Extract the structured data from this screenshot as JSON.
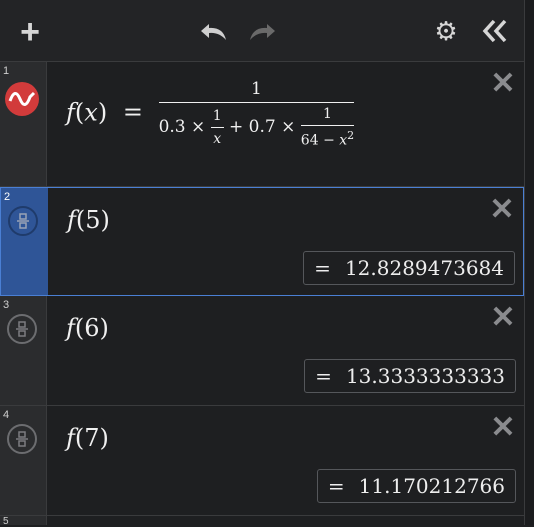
{
  "toolbar": {
    "add_icon": "plus-icon",
    "undo_icon": "undo-icon",
    "redo_icon": "redo-icon",
    "settings_icon": "gear-icon",
    "collapse_icon": "double-chevron-left-icon"
  },
  "expressions": [
    {
      "index": "1",
      "icon": "function-wave-icon",
      "fname": "f",
      "var": "x",
      "numerator": "1",
      "term1_coef": "0.3",
      "term1_num": "1",
      "term1_den": "x",
      "term2_coef": "0.7",
      "term2_num": "1",
      "term2_den_const": "64",
      "term2_den_var": "x",
      "term2_den_exp": "2"
    },
    {
      "index": "2",
      "icon": "fraction-toggle-icon",
      "fname": "f",
      "arg": "5",
      "result": "12.8289473684",
      "active": true
    },
    {
      "index": "3",
      "icon": "fraction-toggle-icon",
      "fname": "f",
      "arg": "6",
      "result": "13.3333333333"
    },
    {
      "index": "4",
      "icon": "fraction-toggle-icon",
      "fname": "f",
      "arg": "7",
      "result": "11.170212766"
    },
    {
      "index": "5"
    }
  ],
  "labels": {
    "equals": "=",
    "times": "×",
    "plus": "+",
    "minus": "−",
    "close": "✕"
  },
  "colors": {
    "accent": "#2f5597",
    "function_icon": "#d23b3b",
    "background": "#1e1f21"
  }
}
